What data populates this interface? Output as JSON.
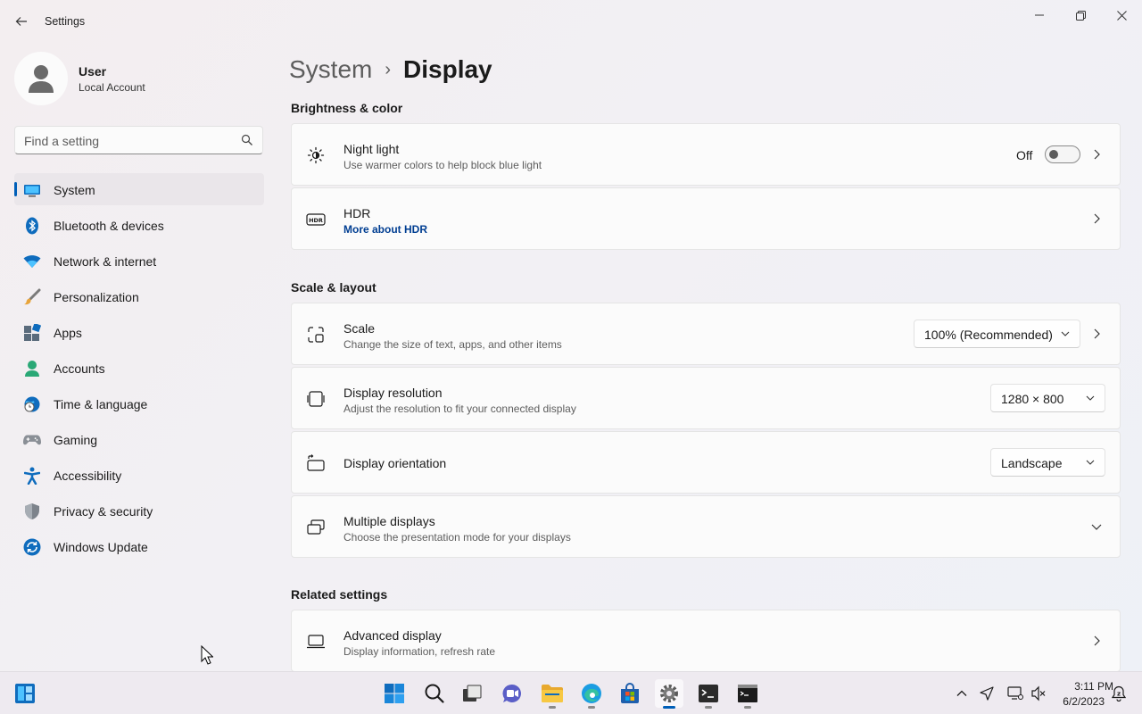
{
  "window": {
    "title": "Settings",
    "back_icon": "back-arrow-icon"
  },
  "profile": {
    "name": "User",
    "account_type": "Local Account"
  },
  "search": {
    "placeholder": "Find a setting"
  },
  "sidebar": {
    "items": [
      {
        "label": "System",
        "icon": "system-icon",
        "active": true
      },
      {
        "label": "Bluetooth & devices",
        "icon": "bluetooth-icon"
      },
      {
        "label": "Network & internet",
        "icon": "wifi-icon"
      },
      {
        "label": "Personalization",
        "icon": "brush-icon"
      },
      {
        "label": "Apps",
        "icon": "apps-icon"
      },
      {
        "label": "Accounts",
        "icon": "accounts-icon"
      },
      {
        "label": "Time & language",
        "icon": "globe-clock-icon"
      },
      {
        "label": "Gaming",
        "icon": "gamepad-icon"
      },
      {
        "label": "Accessibility",
        "icon": "accessibility-icon"
      },
      {
        "label": "Privacy & security",
        "icon": "shield-icon"
      },
      {
        "label": "Windows Update",
        "icon": "update-icon"
      }
    ]
  },
  "breadcrumb": {
    "parent": "System",
    "separator": "›",
    "current": "Display"
  },
  "sections": {
    "brightness": {
      "title": "Brightness & color",
      "night_light": {
        "title": "Night light",
        "subtitle": "Use warmer colors to help block blue light",
        "toggle_state": "Off"
      },
      "hdr": {
        "title": "HDR",
        "link": "More about HDR"
      }
    },
    "scale_layout": {
      "title": "Scale & layout",
      "scale": {
        "title": "Scale",
        "subtitle": "Change the size of text, apps, and other items",
        "value": "100% (Recommended)"
      },
      "resolution": {
        "title": "Display resolution",
        "subtitle": "Adjust the resolution to fit your connected display",
        "value": "1280 × 800"
      },
      "orientation": {
        "title": "Display orientation",
        "value": "Landscape"
      },
      "multiple": {
        "title": "Multiple displays",
        "subtitle": "Choose the presentation mode for your displays"
      }
    },
    "related": {
      "title": "Related settings",
      "advanced": {
        "title": "Advanced display",
        "subtitle": "Display information, refresh rate"
      }
    }
  },
  "taskbar": {
    "clock": {
      "time": "3:11 PM",
      "date": "6/2/2023"
    },
    "accent": "#005fb8"
  }
}
